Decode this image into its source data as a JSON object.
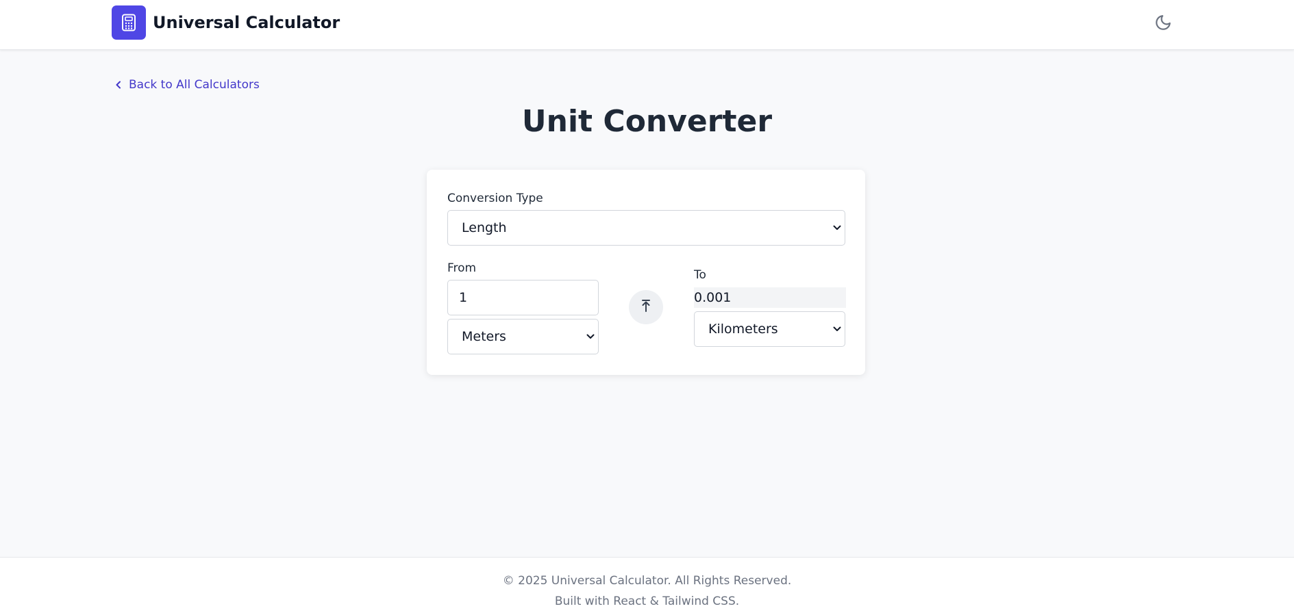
{
  "header": {
    "app_title": "Universal Calculator",
    "logo_icon": "calculator-icon",
    "theme_icon": "moon-icon",
    "brand_color": "#4f46e5"
  },
  "nav": {
    "back_label": "Back to All Calculators",
    "back_icon": "chevron-left-icon"
  },
  "main": {
    "title": "Unit Converter",
    "conversion_type": {
      "label": "Conversion Type",
      "value": "Length"
    },
    "from": {
      "label": "From",
      "value": "1",
      "unit": "Meters"
    },
    "swap_icon": "arrow-up-icon",
    "to": {
      "label": "To",
      "value": "0.001",
      "unit": "Kilometers"
    }
  },
  "footer": {
    "copyright": "© 2025 Universal Calculator. All Rights Reserved.",
    "built_with": "Built with React & Tailwind CSS."
  }
}
